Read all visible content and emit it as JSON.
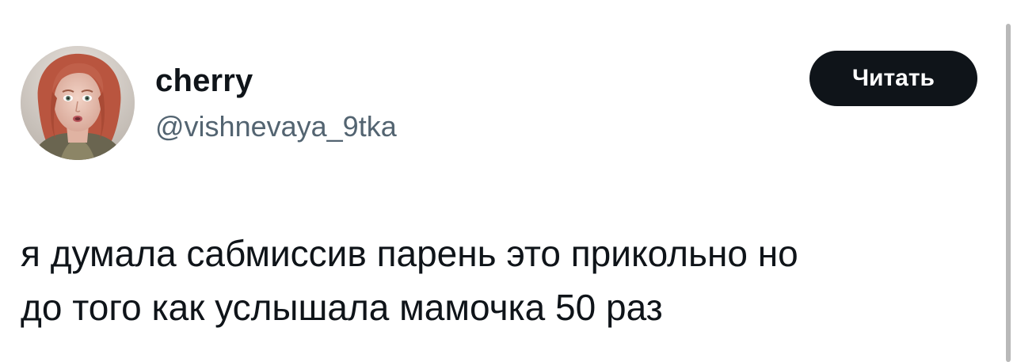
{
  "tweet": {
    "author": {
      "display_name": "cherry",
      "handle": "@vishnevaya_9tka",
      "avatar_icon": "profile-photo-icon"
    },
    "follow_button_label": "Читать",
    "text_lines": [
      "я думала сабмиссив парень это прикольно но",
      "до того как услышала мамочка 50 раз"
    ]
  },
  "colors": {
    "text_primary": "#0f1419",
    "text_secondary": "#536471",
    "button_bg": "#0f1419",
    "button_text": "#ffffff",
    "background": "#ffffff"
  }
}
